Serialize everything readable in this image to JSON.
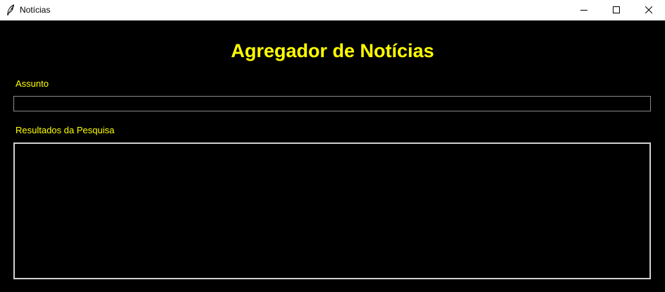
{
  "window": {
    "title": "Notícias",
    "icon": "feather-icon"
  },
  "controls": {
    "minimize_icon": "minimize-icon",
    "maximize_icon": "maximize-icon",
    "close_icon": "close-icon"
  },
  "main": {
    "heading": "Agregador de Notícias",
    "subject_label": "Assunto",
    "subject_value": "",
    "results_label": "Resultados da Pesquisa",
    "results_value": ""
  },
  "colors": {
    "background": "#000000",
    "accent_text": "#ffff00",
    "titlebar": "#ffffff"
  }
}
